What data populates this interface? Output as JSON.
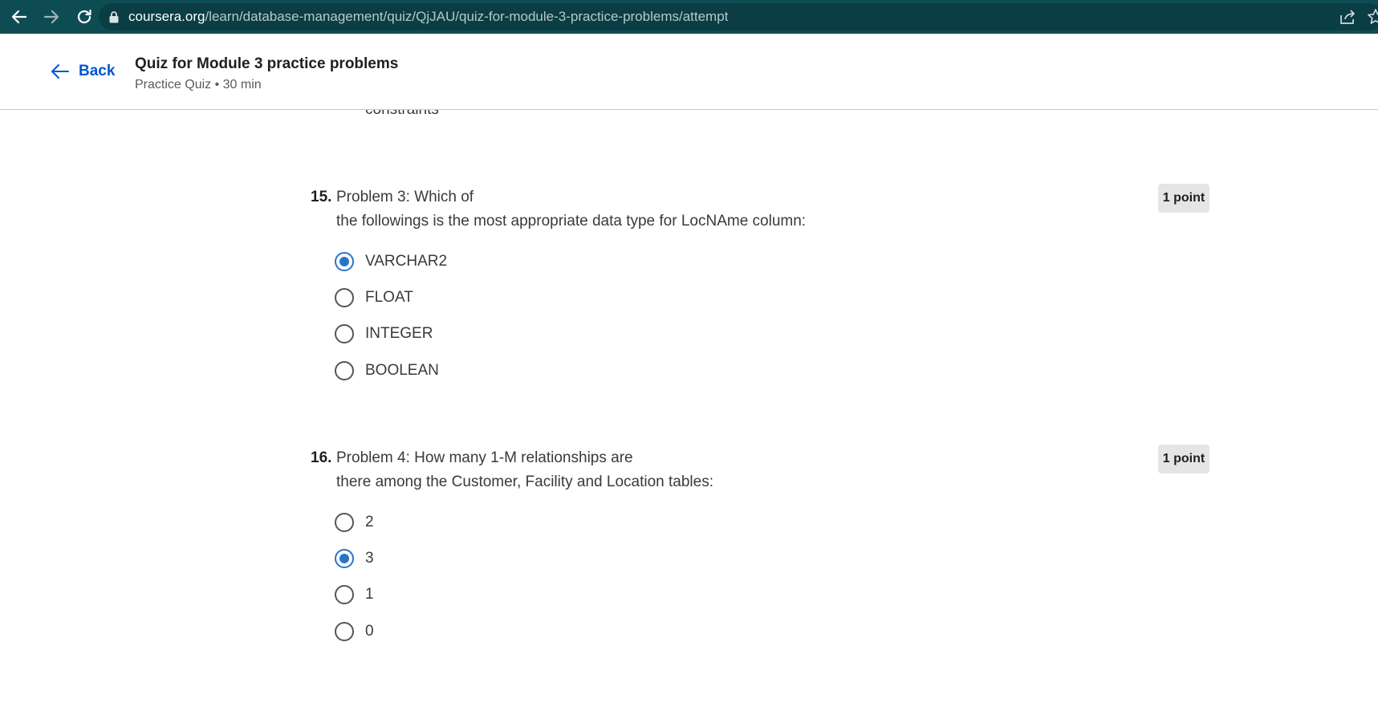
{
  "browser": {
    "url_domain": "coursera.org",
    "url_path": "/learn/database-management/quiz/QjJAU/quiz-for-module-3-practice-problems/attempt",
    "icons": [
      "back-icon",
      "forward-icon",
      "reload-icon",
      "lock-icon",
      "share-icon",
      "star-icon"
    ]
  },
  "header": {
    "back_label": "Back",
    "title": "Quiz for Module 3 practice problems",
    "meta": "Practice Quiz • 30 min"
  },
  "previous_option_fragment": "constraints",
  "questions": [
    {
      "number": "15.",
      "line1": "Problem 3: Which of",
      "line2": "the followings is the most appropriate data type for LocNAme column:",
      "points": "1 point",
      "options": [
        {
          "label": "VARCHAR2",
          "selected": true
        },
        {
          "label": "FLOAT",
          "selected": false
        },
        {
          "label": "INTEGER",
          "selected": false
        },
        {
          "label": "BOOLEAN",
          "selected": false
        }
      ]
    },
    {
      "number": "16.",
      "line1": "Problem 4: How many 1-M relationships are",
      "line2": "there among the Customer, Facility and Location tables:",
      "points": "1 point",
      "options": [
        {
          "label": "2",
          "selected": false
        },
        {
          "label": "3",
          "selected": true
        },
        {
          "label": "1",
          "selected": false
        },
        {
          "label": "0",
          "selected": false
        }
      ]
    }
  ],
  "colors": {
    "browser_bar": "#0e4c54",
    "link_blue": "#0056d2",
    "radio_selected": "#2a73cc",
    "badge_bg": "#e5e5e5"
  }
}
